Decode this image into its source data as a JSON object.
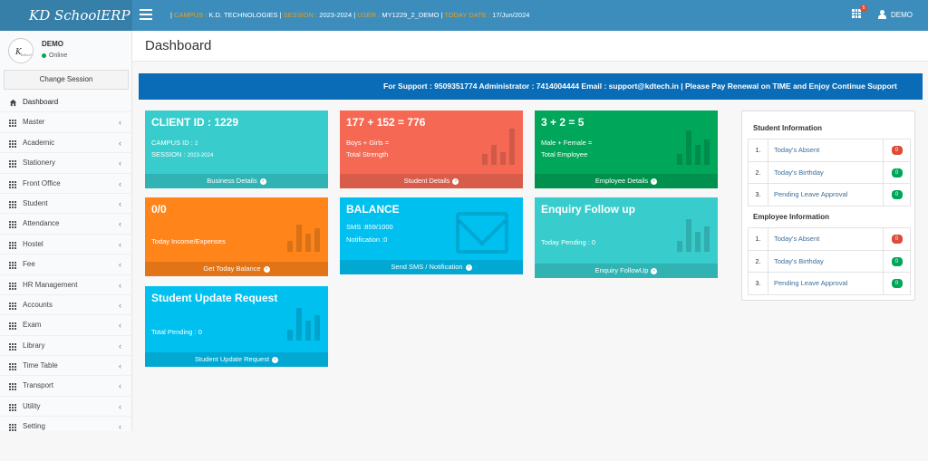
{
  "header": {
    "brand": "KD SchoolERP",
    "campus_label": "CAMPUS :",
    "campus_value": "K.D. TECHNOLOGIES",
    "session_label": "SESSION :",
    "session_value": "2023-2024",
    "user_label": "USER :",
    "user_value": "MY1229_2_DEMO",
    "date_label": "TODAY DATE :",
    "date_value": "17/Jun/2024",
    "notification_count": "5",
    "user_menu_label": "DEMO"
  },
  "sidebar": {
    "user_name": "DEMO",
    "status": "Online",
    "change_session": "Change Session",
    "dashboard_label": "Dashboard",
    "items": [
      {
        "label": "Master"
      },
      {
        "label": "Academic"
      },
      {
        "label": "Stationery"
      },
      {
        "label": "Front Office"
      },
      {
        "label": "Student"
      },
      {
        "label": "Attendance"
      },
      {
        "label": "Hostel"
      },
      {
        "label": "Fee"
      },
      {
        "label": "HR Management"
      },
      {
        "label": "Accounts"
      },
      {
        "label": "Exam"
      },
      {
        "label": "Library"
      },
      {
        "label": "Time Table"
      },
      {
        "label": "Transport"
      },
      {
        "label": "Utility"
      },
      {
        "label": "Setting"
      }
    ]
  },
  "page": {
    "title": "Dashboard",
    "support_text": "For Support : 9509351774 Administrator : 7414004444 Email : support@kdtech.in    |    Please Pay Renewal on TIME and Enjoy Continue Support"
  },
  "boxes": {
    "client": {
      "title": "CLIENT ID : 1229",
      "line1": "CAMPUS ID :",
      "line1_val": "2",
      "line2": "SESSION :",
      "line2_val": "2023-2024",
      "footer": "Business Details"
    },
    "strength": {
      "title": "177 + 152 = 776",
      "line1": "Boys + Girls =",
      "line2": "Total Strength",
      "footer": "Student Details"
    },
    "employee": {
      "title": "3 + 2 = 5",
      "line1": "Male + Female =",
      "line2": "Total Employee",
      "footer": "Employee Details"
    },
    "income": {
      "title": "0/0",
      "line1": "Today Income/Expenses",
      "footer": "Get Today Balance"
    },
    "balance": {
      "title": "BALANCE",
      "line1": "SMS :859/1000",
      "line2": "Notification :0",
      "footer": "Send SMS / Notification"
    },
    "enquiry": {
      "title": "Enquiry Follow up",
      "line1": "Today Pending : 0",
      "footer": "Enquiry FollowUp"
    },
    "update": {
      "title": "Student Update Request",
      "line1": "Total Pending : 0",
      "footer": "Student Update Request"
    }
  },
  "student_info": {
    "heading": "Student Information",
    "rows": [
      {
        "num": "1.",
        "label": "Today's Absent",
        "count": "0",
        "color": "#dd4b39"
      },
      {
        "num": "2.",
        "label": "Today's Birthday",
        "count": "0",
        "color": "#00a65a"
      },
      {
        "num": "3.",
        "label": "Pending Leave Approval",
        "count": "0",
        "color": "#00a65a"
      }
    ]
  },
  "employee_info": {
    "heading": "Employee Information",
    "rows": [
      {
        "num": "1.",
        "label": "Today's Absent",
        "count": "0",
        "color": "#dd4b39"
      },
      {
        "num": "2.",
        "label": "Today's Birthday",
        "count": "0",
        "color": "#00a65a"
      },
      {
        "num": "3.",
        "label": "Pending Leave Approval",
        "count": "0",
        "color": "#00a65a"
      }
    ]
  }
}
